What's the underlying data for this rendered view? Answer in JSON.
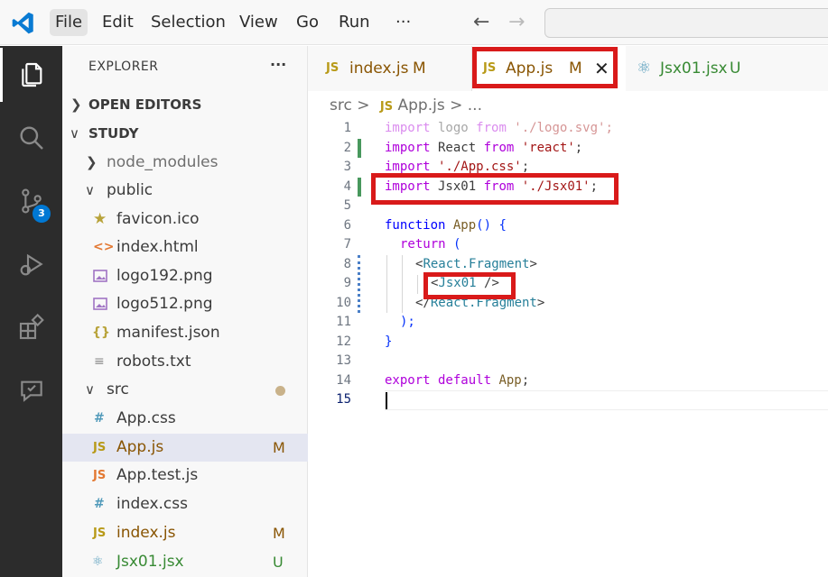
{
  "menu": [
    "File",
    "Edit",
    "Selection",
    "View",
    "Go",
    "Run",
    "···"
  ],
  "explorer": {
    "title": "EXPLORER",
    "more": "···",
    "open_editors": "OPEN EDITORS",
    "root": "STUDY",
    "items": [
      {
        "label": "node_modules",
        "icon": "chevron-right",
        "status": ""
      },
      {
        "label": "public",
        "icon": "chevron-down",
        "status": ""
      },
      {
        "label": "favicon.ico",
        "icon": "star-icon",
        "status": ""
      },
      {
        "label": "index.html",
        "icon": "html-icon",
        "status": ""
      },
      {
        "label": "logo192.png",
        "icon": "image-icon",
        "status": ""
      },
      {
        "label": "logo512.png",
        "icon": "image-icon",
        "status": ""
      },
      {
        "label": "manifest.json",
        "icon": "json-icon",
        "status": ""
      },
      {
        "label": "robots.txt",
        "icon": "text-file-icon",
        "status": ""
      },
      {
        "label": "src",
        "icon": "chevron-down",
        "status": ""
      },
      {
        "label": "App.css",
        "icon": "css-icon",
        "status": ""
      },
      {
        "label": "App.js",
        "icon": "js-icon",
        "status": "M"
      },
      {
        "label": "App.test.js",
        "icon": "test-js-icon",
        "status": ""
      },
      {
        "label": "index.css",
        "icon": "css-icon",
        "status": ""
      },
      {
        "label": "index.js",
        "icon": "js-icon",
        "status": "M"
      },
      {
        "label": "Jsx01.jsx",
        "icon": "react-icon",
        "status": "U"
      }
    ]
  },
  "activity": {
    "scm_badge": "3"
  },
  "tabs": [
    {
      "icon_text": "JS",
      "label": "index.js",
      "status": "M"
    },
    {
      "icon_text": "JS",
      "label": "App.js",
      "status": "M"
    },
    {
      "icon_text": "",
      "label": "Jsx01.jsx",
      "status": "U"
    }
  ],
  "breadcrumb": {
    "folder": "src",
    "sep": ">",
    "icon_text": "JS",
    "file": "App.js",
    "rest": "> ..."
  },
  "code": {
    "line_numbers": [
      "1",
      "2",
      "3",
      "4",
      "5",
      "6",
      "7",
      "8",
      "9",
      "10",
      "11",
      "12",
      "13",
      "14",
      "15"
    ],
    "l1": [
      "import",
      " logo ",
      "from",
      " './logo.svg';"
    ],
    "l2": [
      "import",
      " React ",
      "from",
      " 'react'",
      ";"
    ],
    "l3": [
      "import",
      " './App.css'",
      ";"
    ],
    "l4": [
      "import",
      " Jsx01 ",
      "from",
      " './Jsx01'",
      ";"
    ],
    "l6": [
      "function",
      " App",
      "()",
      " {"
    ],
    "l7": [
      "return",
      " ("
    ],
    "l8": [
      "<",
      "React.Fragment",
      ">"
    ],
    "l9": [
      "<",
      "Jsx01",
      " />"
    ],
    "l10": [
      "</",
      "React.Fragment",
      ">"
    ],
    "l11": [
      ");"
    ],
    "l12": [
      "}"
    ],
    "l14": [
      "export",
      " default",
      " App",
      ";"
    ]
  },
  "colors": {
    "highlight_box": "#d91a1a",
    "accent": "#0078d4"
  }
}
